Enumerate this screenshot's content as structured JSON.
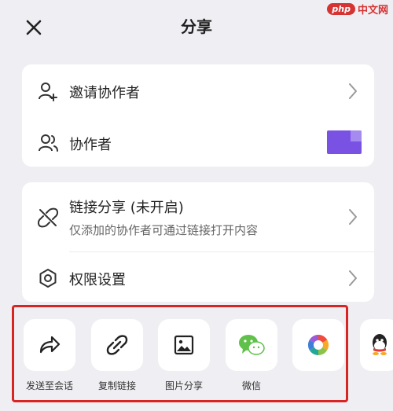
{
  "header": {
    "title": "分享"
  },
  "watermark": {
    "badge": "php",
    "text": "中文网"
  },
  "collaborators": {
    "invite_label": "邀请协作者",
    "list_label": "协作者"
  },
  "link_share": {
    "title": "链接分享 (未开启)",
    "subtitle": "仅添加的协作者可通过链接打开内容",
    "permissions_label": "权限设置"
  },
  "share_targets": [
    {
      "label": "发送至会话",
      "icon": "share-arrow-icon"
    },
    {
      "label": "复制链接",
      "icon": "link-icon"
    },
    {
      "label": "图片分享",
      "icon": "image-icon"
    },
    {
      "label": "微信",
      "icon": "wechat-icon"
    },
    {
      "label": "",
      "icon": "moments-icon"
    },
    {
      "label": "",
      "icon": "qq-icon"
    }
  ],
  "colors": {
    "background": "#efeef2",
    "card": "#ffffff",
    "avatar": "#7a52e3",
    "wechat_green": "#5fc04a",
    "highlight_frame": "#d92424"
  }
}
